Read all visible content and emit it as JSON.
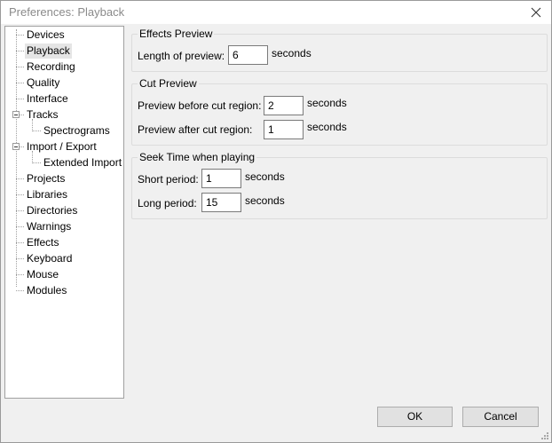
{
  "window": {
    "title": "Preferences: Playback",
    "close_icon": "close-icon"
  },
  "tree": {
    "items": [
      {
        "label": "Devices"
      },
      {
        "label": "Playback"
      },
      {
        "label": "Recording"
      },
      {
        "label": "Quality"
      },
      {
        "label": "Interface"
      },
      {
        "label": "Tracks"
      },
      {
        "label": "Spectrograms"
      },
      {
        "label": "Import / Export"
      },
      {
        "label": "Extended Import"
      },
      {
        "label": "Projects"
      },
      {
        "label": "Libraries"
      },
      {
        "label": "Directories"
      },
      {
        "label": "Warnings"
      },
      {
        "label": "Effects"
      },
      {
        "label": "Keyboard"
      },
      {
        "label": "Mouse"
      },
      {
        "label": "Modules"
      }
    ],
    "selected": "Playback"
  },
  "effects_preview": {
    "title": "Effects Preview",
    "length_label": "Length of preview:",
    "length_value": "6",
    "length_unit": "seconds"
  },
  "cut_preview": {
    "title": "Cut Preview",
    "before_label": "Preview before cut region:",
    "before_value": "2",
    "before_unit": "seconds",
    "after_label": "Preview after cut region:",
    "after_value": "1",
    "after_unit": "seconds"
  },
  "seek_time": {
    "title": "Seek Time when playing",
    "short_label": "Short period:",
    "short_value": "1",
    "short_unit": "seconds",
    "long_label": "Long period:",
    "long_value": "15",
    "long_unit": "seconds"
  },
  "buttons": {
    "ok": "OK",
    "cancel": "Cancel"
  },
  "colors": {
    "selected_bg": "#e5e5e5",
    "window_bg": "#f0f0f0"
  }
}
